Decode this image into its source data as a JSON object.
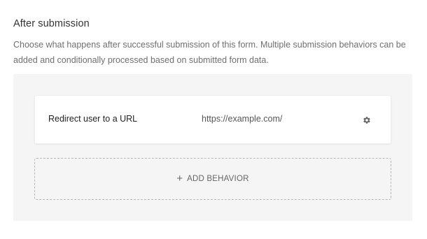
{
  "section": {
    "title": "After submission",
    "description": "Choose what happens after successful submission of this form. Multiple submission behaviors can be added and conditionally processed based on submitted form data."
  },
  "behaviors": [
    {
      "name": "Redirect user to a URL",
      "value": "https://example.com/",
      "settings_icon": "gear-icon"
    }
  ],
  "add_behavior": {
    "icon": "plus-icon",
    "icon_glyph": "+",
    "label": "ADD BEHAVIOR"
  },
  "colors": {
    "panel_background": "#f5f5f5",
    "card_background": "#ffffff",
    "dashed_border": "#b8b8b8"
  }
}
